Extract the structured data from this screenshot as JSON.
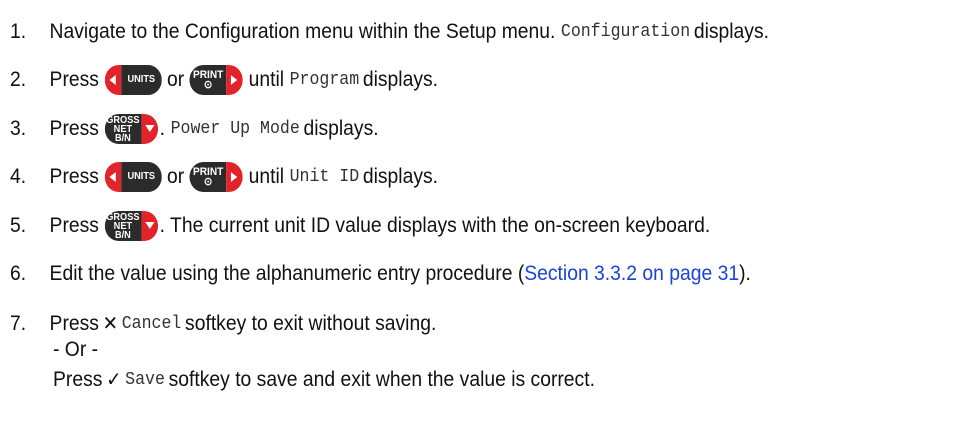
{
  "steps": [
    {
      "num": "1.",
      "a": "Navigate to the Configuration menu within the Setup menu.",
      "code": "Configuration",
      "b": "displays."
    },
    {
      "num": "2.",
      "a": "Press",
      "or": "or",
      "until": "until",
      "code": "Program",
      "b": "displays."
    },
    {
      "num": "3.",
      "a": "Press",
      "code": "Power Up Mode",
      "b": "displays."
    },
    {
      "num": "4.",
      "a": "Press",
      "or": "or",
      "until": "until",
      "code": "Unit ID",
      "b": "displays."
    },
    {
      "num": "5.",
      "a": "Press",
      "b": ". The current unit ID value displays with the on-screen keyboard."
    },
    {
      "num": "6.",
      "a": "Edit the value using the alphanumeric entry procedure (",
      "link": "Section 3.3.2 on page 31",
      "b": ")."
    },
    {
      "num": "7.",
      "a": "Press",
      "code": "Cancel",
      "b": "softkey to exit without saving.",
      "or_line": "- Or -",
      "c": "Press",
      "code2": "Save",
      "d": "softkey to save and exit when the value is correct."
    }
  ],
  "keys": {
    "units": "UNITS",
    "print_top": "PRINT",
    "print_bottom": "⊙",
    "gross_1": "GROSS",
    "gross_2": "NET",
    "gross_3": "B/N"
  },
  "icons": {
    "cancel": "x-icon",
    "save": "check-icon"
  }
}
